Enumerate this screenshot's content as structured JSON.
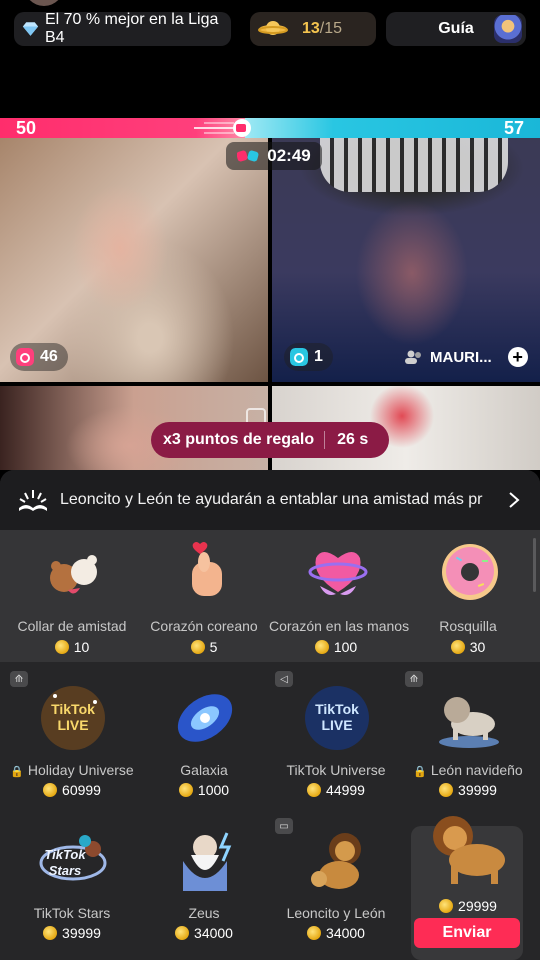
{
  "top": {
    "league_text": "El 70 % mejor en la Liga B4",
    "progress_current": "13",
    "progress_total": "/15",
    "guide_label": "Guía"
  },
  "battle": {
    "score_left": "50",
    "score_right": "57",
    "left_color": "#ff2d6c",
    "right_color": "#29c6e2",
    "timer": "02:49"
  },
  "streams": {
    "left_count": "46",
    "right_count": "1",
    "right_host": "MAURI..."
  },
  "gift_points": {
    "label": "x3 puntos de regalo",
    "seconds": "26 s"
  },
  "promo": {
    "text": "Leoncito y León te ayudarán a entablar una amistad más pr"
  },
  "gifts_row1": [
    {
      "name": "Collar de amistad",
      "price": "10",
      "icon": "teddy-bears-icon"
    },
    {
      "name": "Corazón coreano",
      "price": "5",
      "icon": "finger-heart-icon"
    },
    {
      "name": "Corazón en las manos",
      "price": "100",
      "icon": "heart-hands-icon"
    },
    {
      "name": "Rosquilla",
      "price": "30",
      "icon": "donut-icon"
    }
  ],
  "gifts_row2": [
    {
      "name": "Holiday Universe",
      "price": "60999",
      "icon": "tiktok-live-gold-icon"
    },
    {
      "name": "Galaxia",
      "price": "1000",
      "icon": "galaxy-icon"
    },
    {
      "name": "TikTok Universe",
      "price": "44999",
      "icon": "tiktok-live-blue-icon"
    },
    {
      "name": "León navideño",
      "price": "39999",
      "icon": "white-lion-icon"
    }
  ],
  "gifts_row3": [
    {
      "name": "TikTok Stars",
      "price": "39999",
      "icon": "tiktok-stars-icon"
    },
    {
      "name": "Zeus",
      "price": "34000",
      "icon": "zeus-icon"
    },
    {
      "name": "Leoncito y León",
      "price": "34000",
      "icon": "lion-cub-icon"
    },
    {
      "name": "",
      "price": "29999",
      "icon": "lion-icon"
    }
  ],
  "send_label": "Enviar",
  "accent": "#fe2c55"
}
